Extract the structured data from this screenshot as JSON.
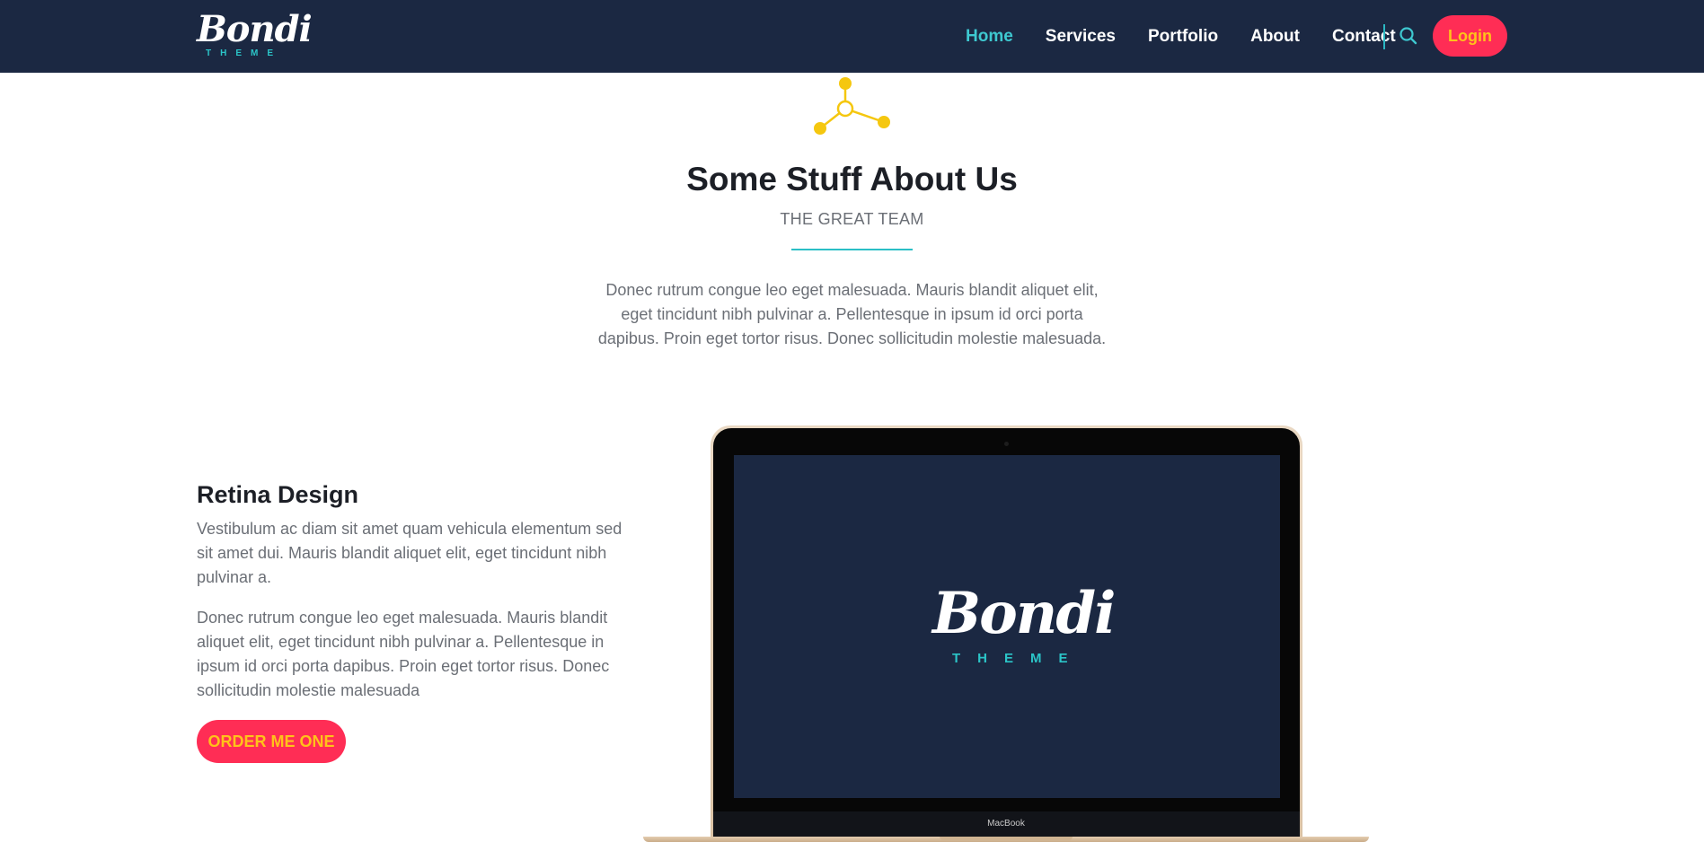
{
  "brand": {
    "name": "Bondi",
    "tagline": "THEME"
  },
  "nav": {
    "items": [
      {
        "label": "Home",
        "active": true
      },
      {
        "label": "Services",
        "active": false
      },
      {
        "label": "Portfolio",
        "active": false
      },
      {
        "label": "About",
        "active": false
      },
      {
        "label": "Contact",
        "active": false
      }
    ],
    "search_icon": "search-icon",
    "login_label": "Login"
  },
  "intro": {
    "icon": "molecule-icon",
    "title": "Some Stuff About Us",
    "subtitle": "THE GREAT TEAM",
    "text": "Donec rutrum congue leo eget malesuada. Mauris blandit aliquet elit, eget tincidunt nibh pulvinar a. Pellentesque in ipsum id orci porta dapibus. Proin eget tortor risus. Donec sollicitudin molestie malesuada."
  },
  "feature": {
    "title": "Retina Design",
    "paragraph1": "Vestibulum ac diam sit amet quam vehicula elementum sed sit amet dui. Mauris blandit aliquet elit, eget tincidunt nibh pulvinar a.",
    "paragraph2": "Donec rutrum congue leo eget malesuada. Mauris blandit aliquet elit, eget tincidunt nibh pulvinar a. Pellentesque in ipsum id orci porta dapibus. Proin eget tortor risus. Donec sollicitudin molestie malesuada",
    "button_label": "ORDER ME ONE"
  },
  "laptop": {
    "brand_label": "MacBook",
    "screen_logo": {
      "name": "Bondi",
      "tagline": "THEME"
    }
  },
  "colors": {
    "navbar_bg": "#1b2842",
    "accent_teal": "#3ec8d0",
    "button_bg": "#ff2d55",
    "button_text": "#ffc21a",
    "icon_yellow": "#f5c70f"
  }
}
